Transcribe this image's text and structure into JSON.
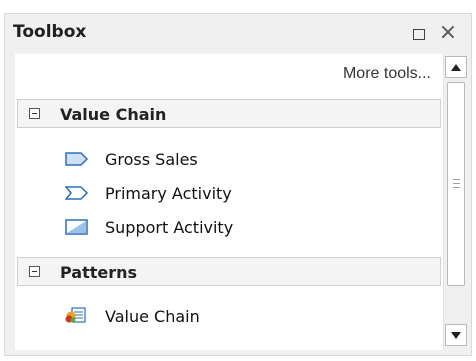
{
  "toolbox": {
    "title": "Toolbox",
    "more_tools": "More tools...",
    "groups": [
      {
        "label": "Value Chain",
        "items": [
          {
            "label": "Gross Sales",
            "icon": "gross-sales-icon"
          },
          {
            "label": "Primary Activity",
            "icon": "primary-activity-icon"
          },
          {
            "label": "Support Activity",
            "icon": "support-activity-icon"
          }
        ]
      },
      {
        "label": "Patterns",
        "items": [
          {
            "label": "Value Chain",
            "icon": "value-chain-pattern-icon"
          }
        ]
      }
    ]
  },
  "colors": {
    "panel_bg": "#f0f0f0",
    "content_bg": "#ffffff",
    "group_header_bg": "#f4f4f4",
    "icon_blue": "#2f6fb8"
  }
}
